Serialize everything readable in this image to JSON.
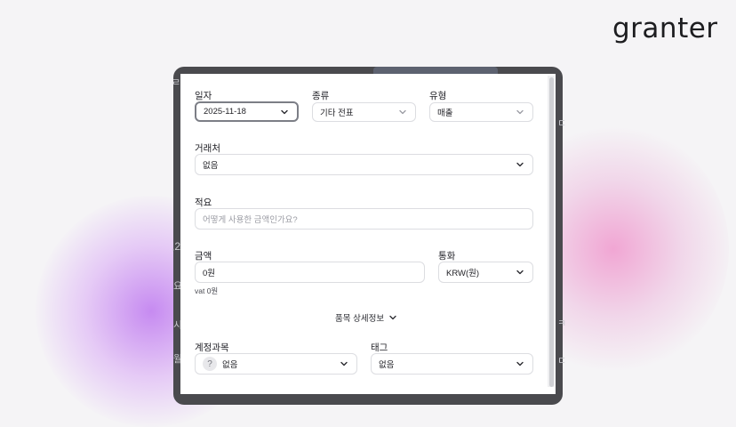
{
  "brand": {
    "logo_text": "granter"
  },
  "form": {
    "date": {
      "label": "일자",
      "value": "2025-11-18"
    },
    "kind": {
      "label": "종류",
      "value": "기타 전표"
    },
    "type": {
      "label": "유형",
      "value": "매출"
    },
    "counterparty": {
      "label": "거래처",
      "value": "없음"
    },
    "memo": {
      "label": "적요",
      "placeholder": "어떻게 사용한 금액인가요?"
    },
    "amount": {
      "label": "금액",
      "value": "0원",
      "vat_hint": "vat 0원"
    },
    "currency": {
      "label": "통화",
      "value": "KRW(원)"
    },
    "details_toggle": "품목 상세정보",
    "account": {
      "label": "계정과목",
      "icon_text": "?",
      "value": "없음"
    },
    "tag": {
      "label": "태그",
      "value": "없음"
    }
  },
  "background_peek": {
    "left_chars": [
      "ㄹ",
      ",2",
      "요",
      "시",
      "월"
    ],
    "right_chars": [
      "ㄷ",
      "ㅋ",
      "ㄷ"
    ]
  },
  "colors": {
    "accent_blob_left": "#be78f0",
    "accent_blob_right": "#f08cc8",
    "frame": "#4a4a4e"
  }
}
